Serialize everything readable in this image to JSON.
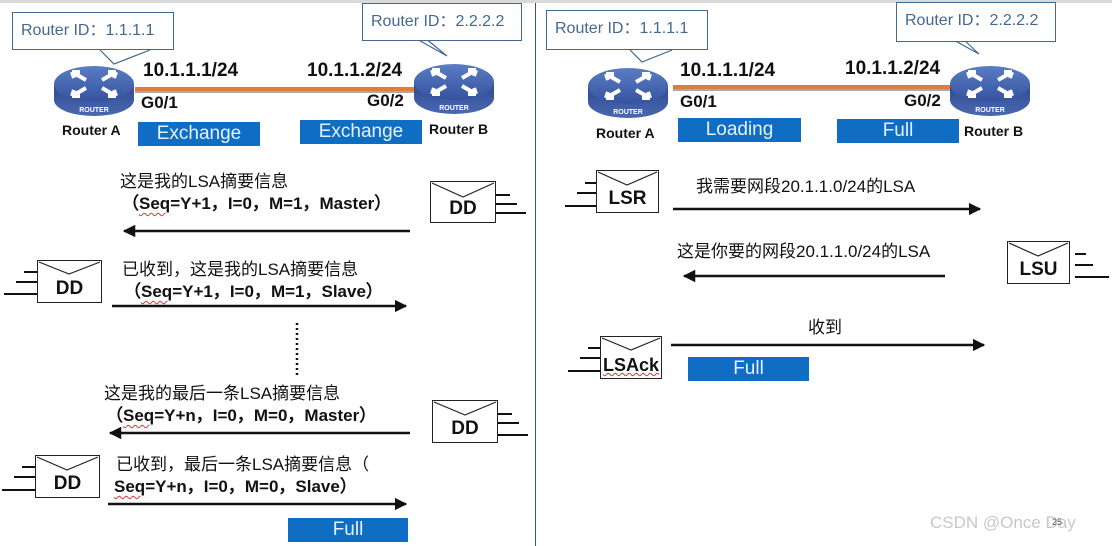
{
  "colors": {
    "state_fill": "#0f6dc4",
    "link": "#e07b39",
    "router": "#3b5ba5",
    "callout": "#44688f"
  },
  "left_panel": {
    "router_a": {
      "callout": "Router ID：1.1.1.1",
      "name": "Router A",
      "ip": "10.1.1.1/24",
      "port": "G0/1",
      "state": "Exchange",
      "badge": "ROUTER"
    },
    "router_b": {
      "callout": "Router ID：2.2.2.2",
      "name": "Router B",
      "ip": "10.1.1.2/24",
      "port": "G0/2",
      "state": "Exchange",
      "badge": "ROUTER"
    },
    "messages": [
      {
        "direction": "left",
        "packet": "DD",
        "line1": "这是我的LSA摘要信息",
        "line2_pre": "（",
        "seq": "Seq",
        "line2_post": "=Y+1，I=0，M=1，Master）"
      },
      {
        "direction": "right",
        "packet": "DD",
        "line1": "已收到，这是我的LSA摘要信息",
        "line2_pre": "（",
        "seq": "Seq",
        "line2_post": "=Y+1，I=0，M=1，Slave）"
      },
      {
        "direction": "left",
        "packet": "DD",
        "line1": "这是我的最后一条LSA摘要信息",
        "line2_pre": "（",
        "seq": "Seq",
        "line2_post": "=Y+n，I=0，M=0，Master）"
      },
      {
        "direction": "right",
        "packet": "DD",
        "line1": "已收到，最后一条LSA摘要信息（",
        "line2_pre": "",
        "seq": "Seq",
        "line2_post": "=Y+n，I=0，M=0，Slave）"
      }
    ],
    "final_state": "Full"
  },
  "right_panel": {
    "router_a": {
      "callout": "Router ID：1.1.1.1",
      "name": "Router A",
      "ip": "10.1.1.1/24",
      "port": "G0/1",
      "state": "Loading",
      "badge": "ROUTER"
    },
    "router_b": {
      "callout": "Router ID：2.2.2.2",
      "name": "Router B",
      "ip": "10.1.1.2/24",
      "port": "G0/2",
      "state": "Full",
      "badge": "ROUTER"
    },
    "messages": [
      {
        "direction": "right",
        "packet": "LSR",
        "text": "我需要网段20.1.1.0/24的LSA"
      },
      {
        "direction": "left",
        "packet": "LSU",
        "text": "这是你要的网段20.1.1.0/24的LSA"
      },
      {
        "direction": "right",
        "packet": "LSAck",
        "text": "收到"
      }
    ],
    "final_state": "Full"
  },
  "watermark": "CSDN @Once Day",
  "page_number": "25"
}
